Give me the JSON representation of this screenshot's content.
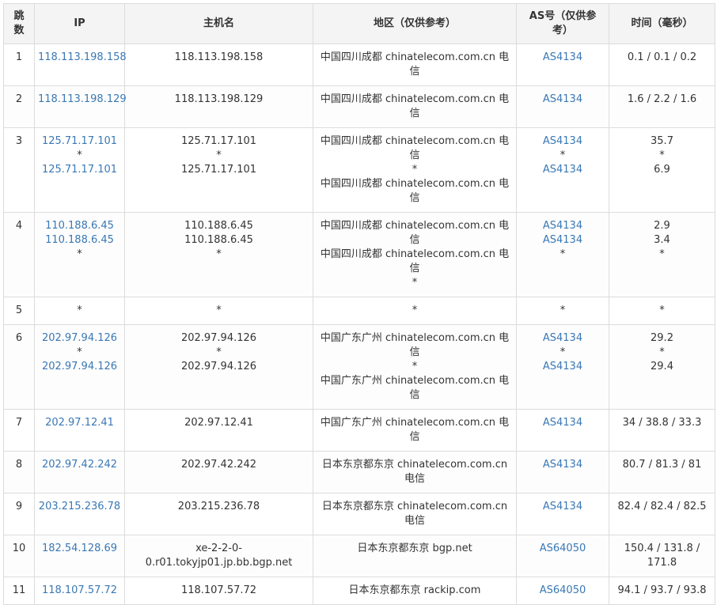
{
  "headers": {
    "hop": "跳数",
    "ip": "IP",
    "host": "主机名",
    "location": "地区（仅供参考）",
    "asn": "AS号（仅供参考）",
    "time": "时间（毫秒）"
  },
  "rows": [
    {
      "hop": "1",
      "ip": [
        "118.113.198.158"
      ],
      "host": [
        "118.113.198.158"
      ],
      "loc": [
        "中国四川成都 chinatelecom.com.cn 电信"
      ],
      "asn": [
        "AS4134"
      ],
      "time": [
        "0.1 / 0.1 / 0.2"
      ]
    },
    {
      "hop": "2",
      "ip": [
        "118.113.198.129"
      ],
      "host": [
        "118.113.198.129"
      ],
      "loc": [
        "中国四川成都 chinatelecom.com.cn 电信"
      ],
      "asn": [
        "AS4134"
      ],
      "time": [
        "1.6 / 2.2 / 1.6"
      ]
    },
    {
      "hop": "3",
      "ip": [
        "125.71.17.101",
        "*",
        "125.71.17.101"
      ],
      "host": [
        "125.71.17.101",
        "*",
        "125.71.17.101"
      ],
      "loc": [
        "中国四川成都 chinatelecom.com.cn 电信",
        "*",
        "中国四川成都 chinatelecom.com.cn 电信"
      ],
      "asn": [
        "AS4134",
        "*",
        "AS4134"
      ],
      "time": [
        "35.7",
        "*",
        "6.9"
      ]
    },
    {
      "hop": "4",
      "ip": [
        "110.188.6.45",
        "110.188.6.45",
        "*"
      ],
      "host": [
        "110.188.6.45",
        "110.188.6.45",
        "*"
      ],
      "loc": [
        "中国四川成都 chinatelecom.com.cn 电信",
        "中国四川成都 chinatelecom.com.cn 电信",
        "*"
      ],
      "asn": [
        "AS4134",
        "AS4134",
        "*"
      ],
      "time": [
        "2.9",
        "3.4",
        "*"
      ]
    },
    {
      "hop": "5",
      "ip": [
        "*"
      ],
      "host": [
        "*"
      ],
      "loc": [
        "*"
      ],
      "asn": [
        "*"
      ],
      "time": [
        "*"
      ]
    },
    {
      "hop": "6",
      "ip": [
        "202.97.94.126",
        "*",
        "202.97.94.126"
      ],
      "host": [
        "202.97.94.126",
        "*",
        "202.97.94.126"
      ],
      "loc": [
        "中国广东广州 chinatelecom.com.cn 电信",
        "*",
        "中国广东广州 chinatelecom.com.cn 电信"
      ],
      "asn": [
        "AS4134",
        "*",
        "AS4134"
      ],
      "time": [
        "29.2",
        "*",
        "29.4"
      ]
    },
    {
      "hop": "7",
      "ip": [
        "202.97.12.41"
      ],
      "host": [
        "202.97.12.41"
      ],
      "loc": [
        "中国广东广州 chinatelecom.com.cn 电信"
      ],
      "asn": [
        "AS4134"
      ],
      "time": [
        "34 / 38.8 / 33.3"
      ]
    },
    {
      "hop": "8",
      "ip": [
        "202.97.42.242"
      ],
      "host": [
        "202.97.42.242"
      ],
      "loc": [
        "日本东京都东京 chinatelecom.com.cn 电信"
      ],
      "asn": [
        "AS4134"
      ],
      "time": [
        "80.7 / 81.3 / 81"
      ]
    },
    {
      "hop": "9",
      "ip": [
        "203.215.236.78"
      ],
      "host": [
        "203.215.236.78"
      ],
      "loc": [
        "日本东京都东京 chinatelecom.com.cn 电信"
      ],
      "asn": [
        "AS4134"
      ],
      "time": [
        "82.4 / 82.4 / 82.5"
      ]
    },
    {
      "hop": "10",
      "ip": [
        "182.54.128.69"
      ],
      "host": [
        "xe-2-2-0-0.r01.tokyjp01.jp.bb.bgp.net"
      ],
      "loc": [
        "日本东京都东京 bgp.net"
      ],
      "asn": [
        "AS64050"
      ],
      "time": [
        "150.4 / 131.8 / 171.8"
      ]
    },
    {
      "hop": "11",
      "ip": [
        "118.107.57.72"
      ],
      "host": [
        "118.107.57.72"
      ],
      "loc": [
        "日本东京都东京 rackip.com"
      ],
      "asn": [
        "AS64050"
      ],
      "time": [
        "94.1 / 93.7 / 93.8"
      ]
    }
  ],
  "colors": {
    "link": "#3a78b4",
    "header_bg": "#f4f4f4",
    "border": "#dcdcdc"
  }
}
